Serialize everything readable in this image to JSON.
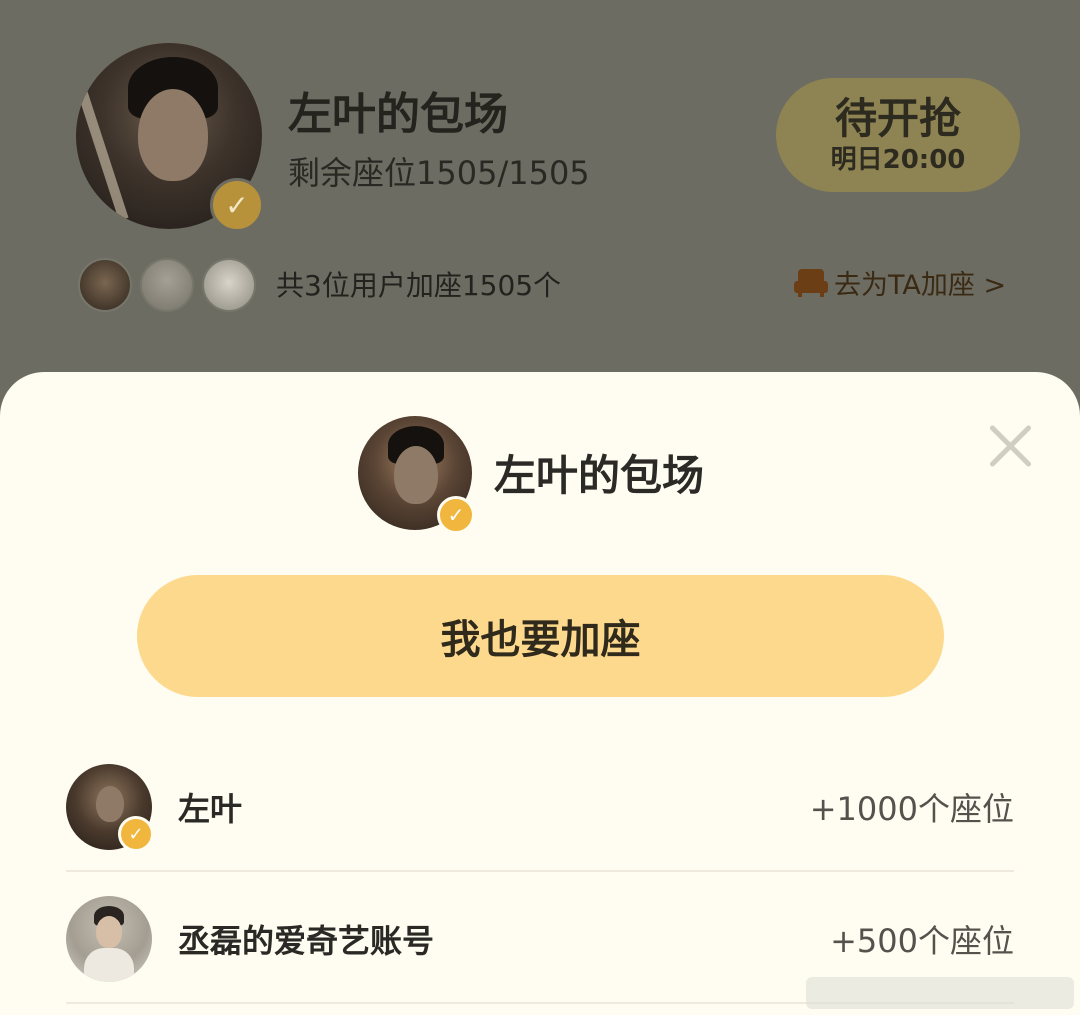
{
  "colors": {
    "overlay_bg": "#6d6c62",
    "sheet_bg": "#fffdf1",
    "button_bg": "#fcd98d",
    "pill_bg": "#8e8352",
    "verified": "#f0b63d",
    "divider": "#efeadb"
  },
  "background_card": {
    "title": "左叶的包场",
    "seats": "剩余座位1505/1505",
    "status_pill": {
      "main": "待开抢",
      "sub": "明日20:00"
    },
    "supporters_text": "共3位用户加座1505个",
    "add_seat_link": "去为TA加座 >",
    "icons": [
      "avatar",
      "verified-icon",
      "sofa-icon"
    ]
  },
  "sheet": {
    "title": "左叶的包场",
    "join_button": "我也要加座",
    "contributors": [
      {
        "name": "左叶",
        "seats": "+1000个座位",
        "verified": true
      },
      {
        "name": "丞磊的爱奇艺账号",
        "seats": "+500个座位",
        "verified": false
      }
    ],
    "icons": [
      "close-icon",
      "verified-icon"
    ]
  }
}
